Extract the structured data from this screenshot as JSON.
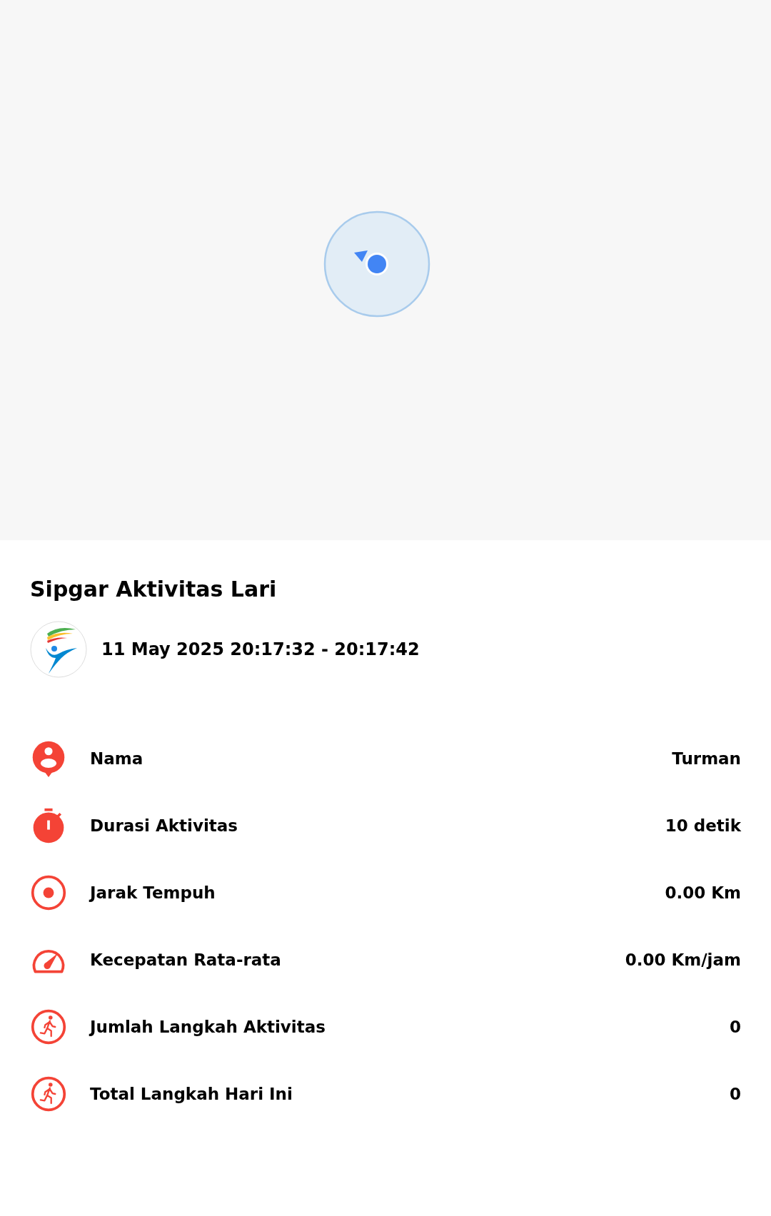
{
  "map": {
    "kind": "map"
  },
  "title": "Sipgar Aktivitas Lari",
  "session": {
    "datetime": "11 May 2025 20:17:32 - 20:17:42"
  },
  "stats": [
    {
      "kind": "person",
      "label": "Nama",
      "value": "Turman"
    },
    {
      "kind": "stopwatch",
      "label": "Durasi Aktivitas",
      "value": "10 detik"
    },
    {
      "kind": "target",
      "label": "Jarak Tempuh",
      "value": "0.00 Km"
    },
    {
      "kind": "speedometer",
      "label": "Kecepatan Rata-rata",
      "value": "0.00 Km/jam"
    },
    {
      "kind": "runner",
      "label": "Jumlah Langkah Aktivitas",
      "value": "0"
    },
    {
      "kind": "runner",
      "label": "Total Langkah Hari Ini",
      "value": "0"
    }
  ]
}
